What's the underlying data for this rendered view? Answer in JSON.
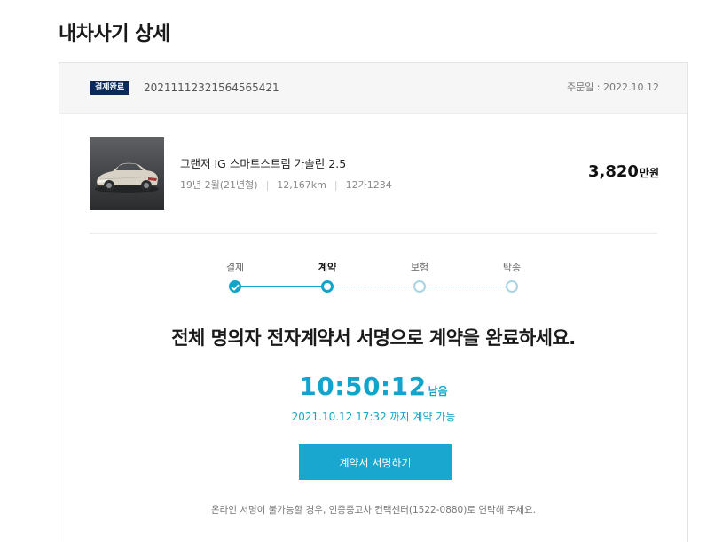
{
  "page": {
    "title": "내차사기 상세"
  },
  "order": {
    "status": "결제완료",
    "number": "20211112321564565421",
    "date_label": "주문일 : 2022.10.12"
  },
  "vehicle": {
    "name": "그랜저 IG 스마트스트림 가솔린 2.5",
    "year": "19년 2월(21년형)",
    "mileage": "12,167km",
    "plate": "12가1234",
    "price": "3,820",
    "price_unit": "만원"
  },
  "steps": [
    {
      "label": "결제",
      "state": "done"
    },
    {
      "label": "계약",
      "state": "current"
    },
    {
      "label": "보험",
      "state": "todo"
    },
    {
      "label": "탁송",
      "state": "todo"
    }
  ],
  "contract": {
    "headline": "전체 명의자 전자계약서 서명으로 계약을 완료하세요.",
    "countdown": "10:50:12",
    "remain_label": "남음",
    "deadline": "2021.10.12 17:32 까지 계약 가능",
    "sign_button": "계약서 서명하기",
    "notice": "온라인 서명이 불가능할 경우, 인증중고차 컨택센터(1522-0880)로 연락해 주세요."
  },
  "colors": {
    "accent": "#13a4cc",
    "badge": "#0b2a5c",
    "step_todo": "#a9d4e3"
  }
}
